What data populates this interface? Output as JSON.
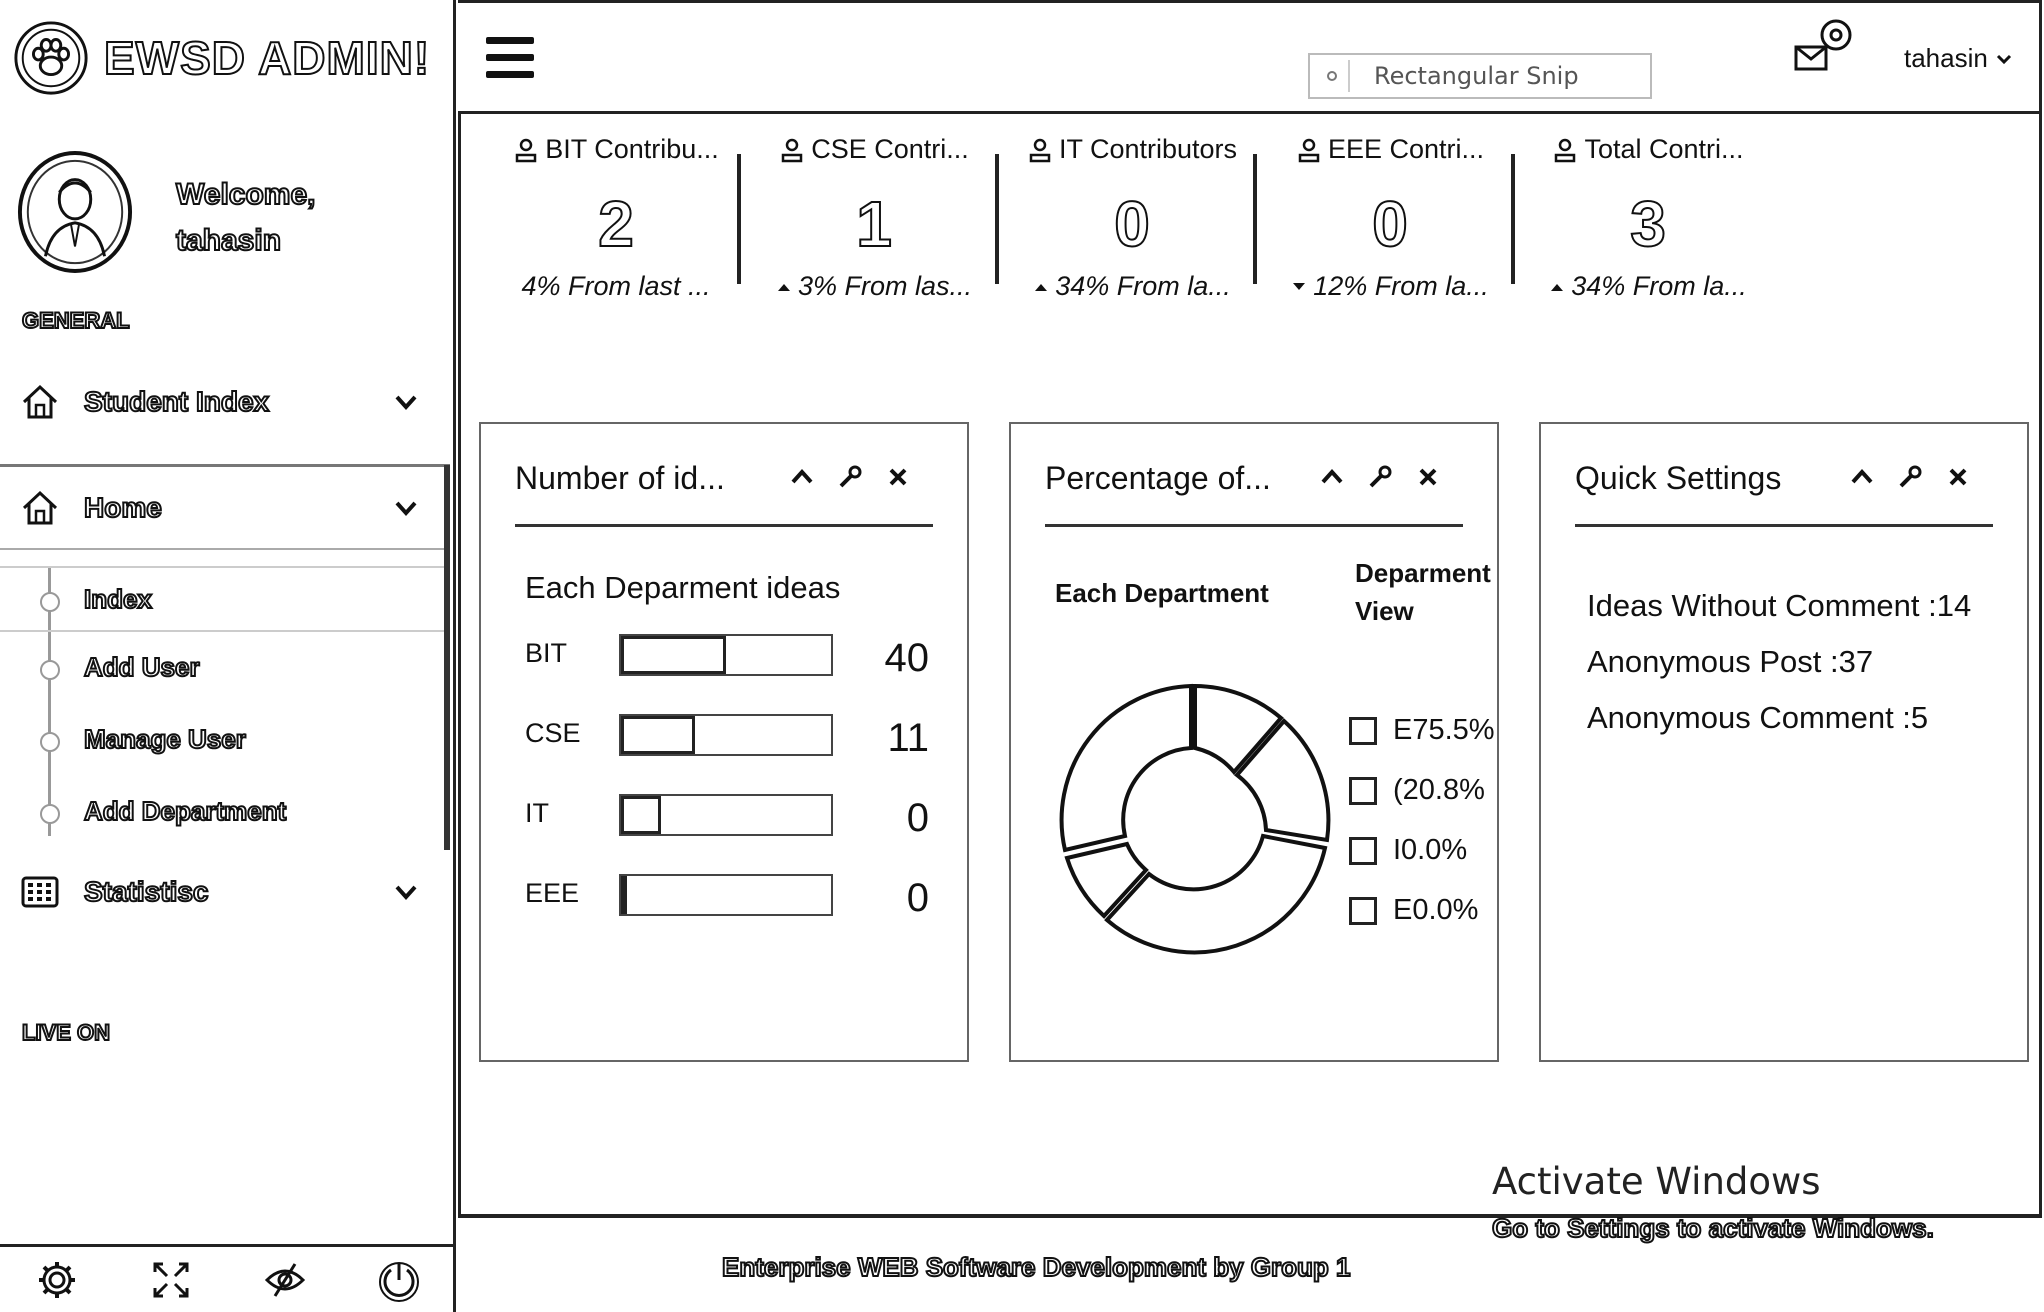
{
  "sidebar": {
    "brand": "EWSD ADMIN!",
    "welcome_line1": "Welcome,",
    "welcome_line2": "tahasin",
    "general_label": "GENERAL",
    "student_index": "Student Index",
    "home": "Home",
    "sub_items": [
      "Index",
      "Add User",
      "Manage User",
      "Add Department"
    ],
    "statistics": "Statistisc",
    "live_label": "LIVE ON",
    "footer_icons": [
      "gear-icon",
      "fullscreen-icon",
      "eye-off-icon",
      "power-icon"
    ]
  },
  "topbar": {
    "snip_label": "Rectangular Snip",
    "username": "tahasin"
  },
  "stats": [
    {
      "label": "BIT Contribu...",
      "value": "2",
      "change": "4% From last ...",
      "trend": "none"
    },
    {
      "label": "CSE Contri...",
      "value": "1",
      "change": "3% From las...",
      "trend": "up"
    },
    {
      "label": "IT Contributors",
      "value": "0",
      "change": "34% From la...",
      "trend": "up"
    },
    {
      "label": "EEE Contri...",
      "value": "0",
      "change": "12% From la...",
      "trend": "down"
    },
    {
      "label": "Total Contri...",
      "value": "3",
      "change": "34% From la...",
      "trend": "up"
    }
  ],
  "panels": {
    "ideas": {
      "title": "Number of id...",
      "subtitle": "Each Deparment ideas",
      "rows": [
        {
          "label": "BIT",
          "value": "40",
          "fill": 0.5
        },
        {
          "label": "CSE",
          "value": "11",
          "fill": 0.35
        },
        {
          "label": "IT",
          "value": "0",
          "fill": 0.19
        },
        {
          "label": "EEE",
          "value": "0",
          "fill": 0.03
        }
      ]
    },
    "percentage": {
      "title": "Percentage of...",
      "left_label": "Each Department",
      "right_label_1": "Deparment",
      "right_label_2": "View",
      "legend": [
        "E75.5%",
        "(20.8%",
        "I0.0%",
        "E0.0%"
      ]
    },
    "quick": {
      "title": "Quick Settings",
      "lines": [
        "Ideas Without Comment :14",
        "Anonymous Post :37",
        "Anonymous Comment :5"
      ]
    }
  },
  "footer": "Enterprise WEB Software Development by Group 1",
  "activate": {
    "title": "Activate Windows",
    "subtitle": "Go to Settings to activate Windows."
  }
}
